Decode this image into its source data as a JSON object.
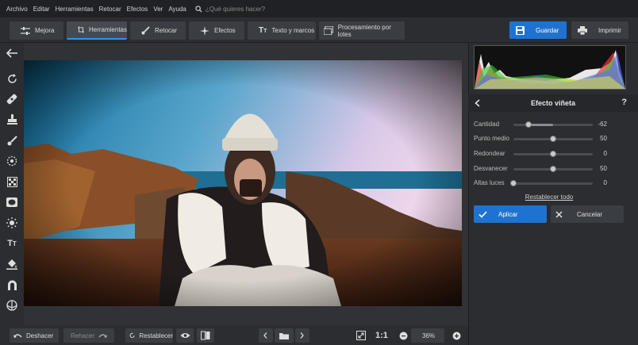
{
  "menu": {
    "items": [
      "Archivo",
      "Editar",
      "Herramientas",
      "Retocar",
      "Efectos",
      "Ver",
      "Ayuda"
    ],
    "search_placeholder": "¿Qué quieres hacer?"
  },
  "tabs": [
    {
      "label": "Mejora",
      "icon": "sliders-icon"
    },
    {
      "label": "Herramientas",
      "icon": "crop-icon",
      "active": true
    },
    {
      "label": "Retocar",
      "icon": "brush-icon"
    },
    {
      "label": "Efectos",
      "icon": "sparkle-icon"
    },
    {
      "label": "Texto y marcos",
      "icon": "text-icon"
    },
    {
      "label": "Procesamiento por lotes",
      "icon": "batch-icon"
    }
  ],
  "actions": {
    "save": "Guardar",
    "print": "Imprimir"
  },
  "panel": {
    "title": "Efecto viñeta",
    "sliders": [
      {
        "label": "Cantidad",
        "value": "-62",
        "level": 0.19
      },
      {
        "label": "Punto medio",
        "value": "50",
        "level": 0.5
      },
      {
        "label": "Redondear",
        "value": "0",
        "level": 0.5
      },
      {
        "label": "Desvanecer",
        "value": "50",
        "level": 0.5
      },
      {
        "label": "Altas luces",
        "value": "0",
        "level": 0.0
      }
    ],
    "reset_all": "Restablecer todo",
    "apply": "Aplicar",
    "cancel": "Cancelar"
  },
  "bottom": {
    "undo": "Deshacer",
    "redo": "Rehacer",
    "reset": "Restablecer",
    "ratio": "1:1",
    "zoom": "36%"
  },
  "colors": {
    "accent": "#1f73d0",
    "panel": "#2b2d30",
    "menubar": "#1f2124"
  }
}
